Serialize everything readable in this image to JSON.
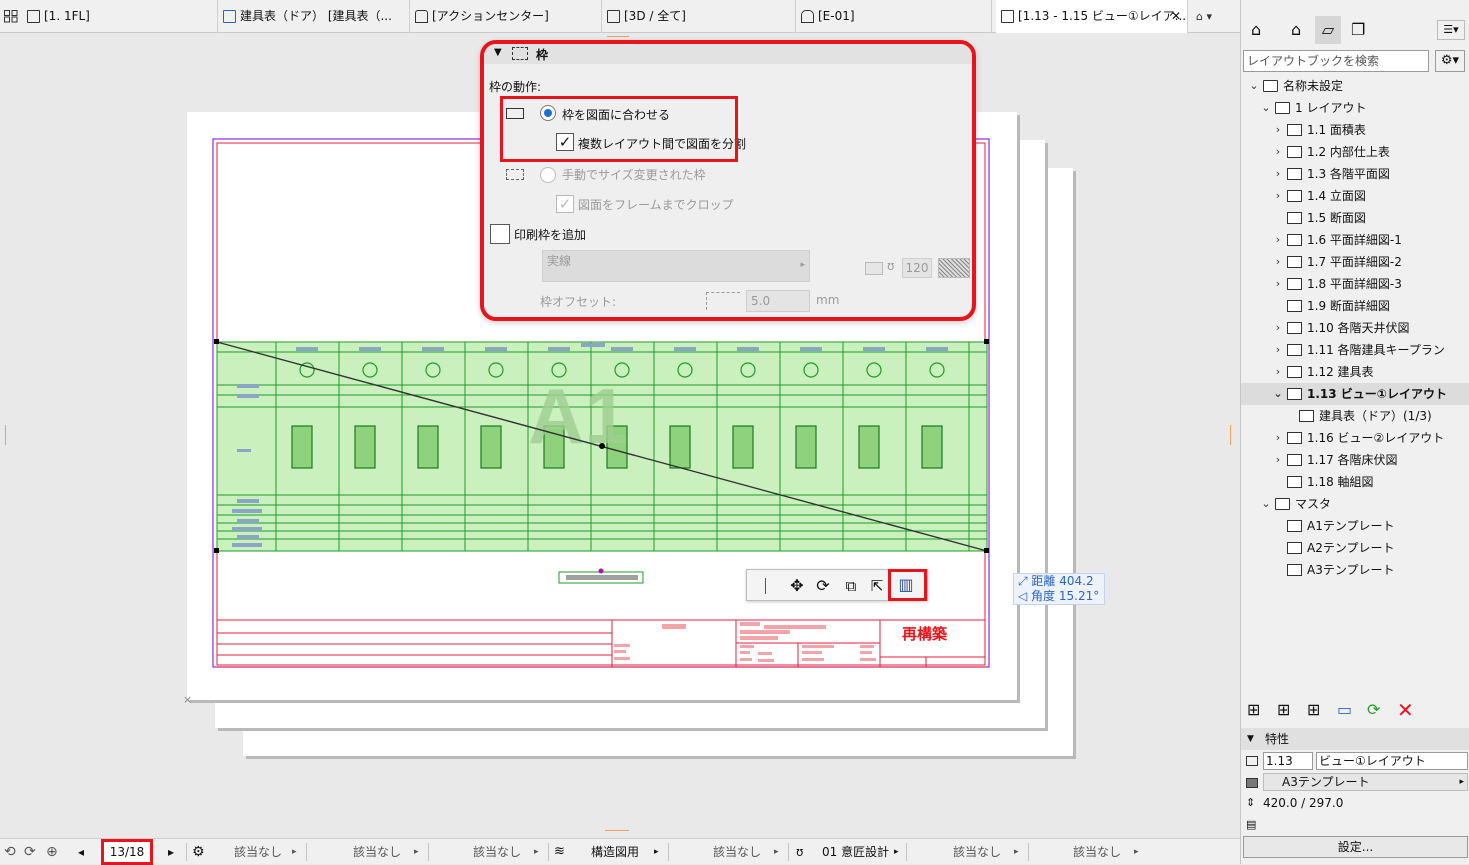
{
  "tabs": [
    {
      "label": "[1. 1FL]"
    },
    {
      "label": "建具表（ドア） [建具表（..."
    },
    {
      "label": "[アクションセンター]"
    },
    {
      "label": "[3D / 全て]"
    },
    {
      "label": "[E-01]"
    },
    {
      "label": "[1.13 - 1.15 ビュー①レイア..."
    }
  ],
  "frame_panel": {
    "title": "枠",
    "section_label": "枠の動作:",
    "option_fit": "枠を図面に合わせる",
    "option_split": "複数レイアウト間で図面を分割",
    "option_manual": "手動でサイズ変更された枠",
    "option_crop": "図面をフレームまでクロップ",
    "add_print_frame": "印刷枠を追加",
    "line_type": "実線",
    "pen_number": "120",
    "offset_label": "枠オフセット:",
    "offset_value": "5.0",
    "unit": "mm"
  },
  "canvas": {
    "sheet_label": "A1",
    "measure_distance": "距離 404.2",
    "measure_angle": "角度 15.21°",
    "rebuild_label": "再構築"
  },
  "status": {
    "page_indicator": "13/18",
    "none1": "該当なし",
    "none2": "該当なし",
    "none3": "該当なし",
    "layer_combo": "構造図用",
    "none4": "該当なし",
    "pen_set": "01 意匠設計",
    "none5": "該当なし",
    "none6": "該当なし"
  },
  "navigator": {
    "search_placeholder": "レイアウトブックを検索",
    "tree": [
      {
        "label": "名称未設定",
        "level": 0,
        "chev": "v"
      },
      {
        "label": "1 レイアウト",
        "level": 1,
        "chev": "v"
      },
      {
        "label": "1.1 面積表",
        "level": 2,
        "chev": ">"
      },
      {
        "label": "1.2 内部仕上表",
        "level": 2,
        "chev": ">"
      },
      {
        "label": "1.3 各階平面図",
        "level": 2,
        "chev": ">"
      },
      {
        "label": "1.4 立面図",
        "level": 2,
        "chev": ">"
      },
      {
        "label": "1.5 断面図",
        "level": 2,
        "chev": ""
      },
      {
        "label": "1.6 平面詳細図-1",
        "level": 2,
        "chev": ">"
      },
      {
        "label": "1.7 平面詳細図-2",
        "level": 2,
        "chev": ">"
      },
      {
        "label": "1.8 平面詳細図-3",
        "level": 2,
        "chev": ">"
      },
      {
        "label": "1.9 断面詳細図",
        "level": 2,
        "chev": ""
      },
      {
        "label": "1.10 各階天井伏図",
        "level": 2,
        "chev": ">"
      },
      {
        "label": "1.11 各階建具キープラン",
        "level": 2,
        "chev": ">"
      },
      {
        "label": "1.12 建具表",
        "level": 2,
        "chev": ">"
      },
      {
        "label": "1.13 ビュー①レイアウト",
        "level": 2,
        "chev": "v",
        "selected": true
      },
      {
        "label": "建具表（ドア）(1/3)",
        "level": 3,
        "chev": ""
      },
      {
        "label": "1.16 ビュー②レイアウト",
        "level": 2,
        "chev": ">"
      },
      {
        "label": "1.17 各階床伏図",
        "level": 2,
        "chev": ">"
      },
      {
        "label": "1.18 軸組図",
        "level": 2,
        "chev": ""
      },
      {
        "label": "マスタ",
        "level": 1,
        "chev": "v"
      },
      {
        "label": "A1テンプレート",
        "level": 2,
        "chev": ""
      },
      {
        "label": "A2テンプレート",
        "level": 2,
        "chev": ""
      },
      {
        "label": "A3テンプレート",
        "level": 2,
        "chev": ""
      }
    ]
  },
  "properties": {
    "header": "特性",
    "id": "1.13",
    "name": "ビュー①レイアウト",
    "master": "A3テンプレート",
    "size": "420.0 / 297.0",
    "settings_button": "設定..."
  }
}
